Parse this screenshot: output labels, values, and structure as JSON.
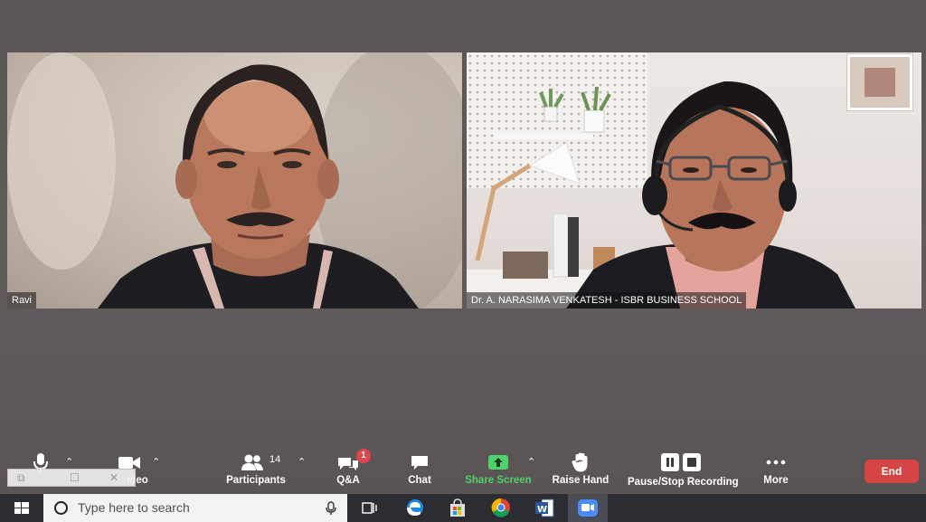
{
  "participants": [
    {
      "name": "Ravi"
    },
    {
      "name": "Dr. A. NARASIMA VENKATESH - ISBR BUSINESS SCHOOL"
    }
  ],
  "toolbar": {
    "video_label": "ideo",
    "participants_label": "Participants",
    "participants_count": "14",
    "qa_label": "Q&A",
    "qa_badge": "1",
    "chat_label": "Chat",
    "share_label": "Share Screen",
    "raise_hand_label": "Raise Hand",
    "recording_label": "Pause/Stop Recording",
    "more_label": "More",
    "end_label": "End"
  },
  "colors": {
    "share_green": "#4fd16b",
    "end_red": "#d64545",
    "badge_red": "#e0464f"
  },
  "taskbar": {
    "search_placeholder": "Type here to search",
    "apps": [
      "task-view",
      "edge",
      "store",
      "chrome",
      "word",
      "zoom"
    ]
  }
}
